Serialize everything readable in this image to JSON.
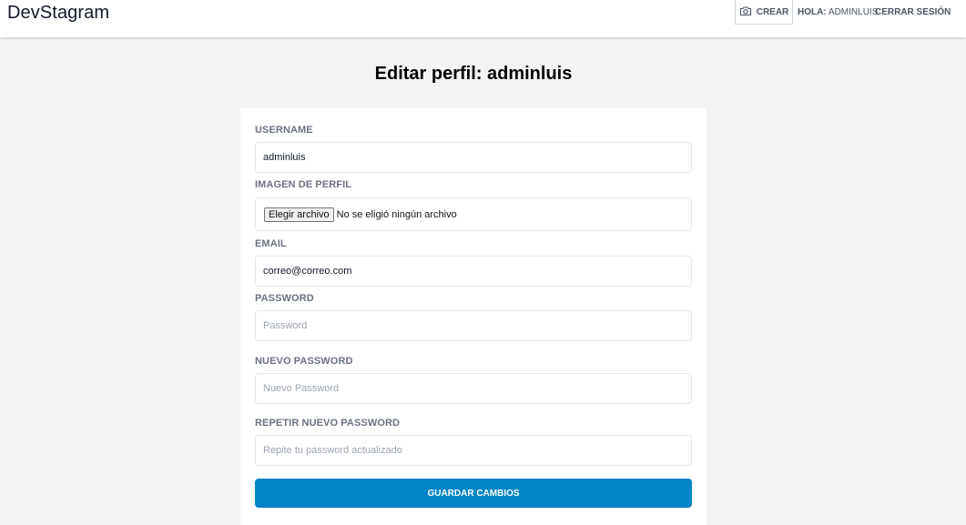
{
  "header": {
    "brand": "DevStagram",
    "create_icon": "camera-icon",
    "create_label": "CREAR",
    "greeting_prefix": "HOLA:",
    "greeting_user": "ADMINLUIS",
    "logout_label": "CERRAR SESIÓN"
  },
  "page": {
    "title": "Editar perfil: adminluis"
  },
  "form": {
    "username_label": "USERNAME",
    "username_value": "adminluis",
    "image_label": "IMAGEN DE PERFIL",
    "file_button": "Elegir archivo",
    "file_status": "No se eligió ningún archivo",
    "email_label": "EMAIL",
    "email_value": "correo@correo.com",
    "password_label": "PASSWORD",
    "password_placeholder": "Password",
    "new_password_label": "NUEVO PASSWORD",
    "new_password_placeholder": "Nuevo Password",
    "repeat_password_label": "REPETIR NUEVO PASSWORD",
    "repeat_password_placeholder": "Repite tu password actualizado",
    "submit_label": "GUARDAR CAMBIOS"
  },
  "colors": {
    "primary_button": "#0284c7",
    "background": "#f3f4f6",
    "label": "#6b7280"
  }
}
